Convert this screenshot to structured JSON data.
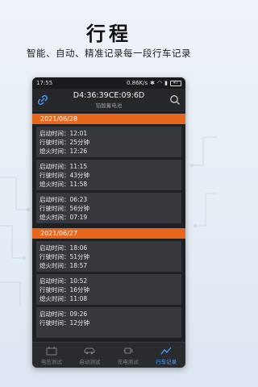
{
  "promo": {
    "title": "行程",
    "subtitle": "智能、自动、精准记录每一段行车记录"
  },
  "statusbar": {
    "time": "17:55",
    "signal": "0.86K/s",
    "battery": "47"
  },
  "header": {
    "device_id": "D4:36:39CE:09:6D",
    "device_type": "铅酸蓄电池"
  },
  "colors": {
    "accent": "#e9671d",
    "active_tab": "#4aa0ff"
  },
  "records": {
    "group1": {
      "date": "2021/06/28",
      "items": [
        {
          "start_label": "启动时间：",
          "start": "12:01",
          "drive_label": "行驶时间：",
          "drive": "25分钟",
          "stop_label": "熄火时间：",
          "stop": "12:26"
        },
        {
          "start_label": "启动时间：",
          "start": "11:15",
          "drive_label": "行驶时间：",
          "drive": "43分钟",
          "stop_label": "熄火时间：",
          "stop": "11:58"
        },
        {
          "start_label": "启动时间：",
          "start": "06:23",
          "drive_label": "行驶时间：",
          "drive": "56分钟",
          "stop_label": "熄火时间：",
          "stop": "07:19"
        }
      ]
    },
    "group2": {
      "date": "2021/06/27",
      "items": [
        {
          "start_label": "启动时间：",
          "start": "18:06",
          "drive_label": "行驶时间：",
          "drive": "51分钟",
          "stop_label": "熄火时间：",
          "stop": "18:57"
        },
        {
          "start_label": "启动时间：",
          "start": "10:52",
          "drive_label": "行驶时间：",
          "drive": "16分钟",
          "stop_label": "熄火时间：",
          "stop": "11:08"
        },
        {
          "start_label": "启动时间：",
          "start": "09:26",
          "drive_label": "行驶时间：",
          "drive": "12分钟",
          "stop_label": "熄火时间：",
          "stop": ""
        }
      ]
    }
  },
  "tabs": {
    "voltage": "电压测试",
    "start": "启动测试",
    "charge": "充电测试",
    "trip": "行车记录"
  }
}
